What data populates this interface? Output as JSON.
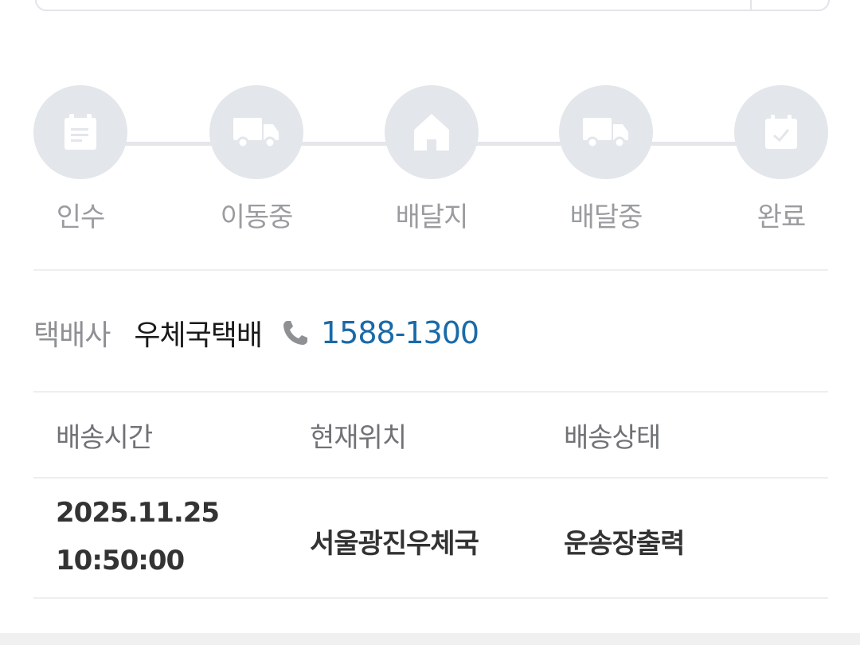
{
  "steps": [
    {
      "label": "인수",
      "icon": "document-icon"
    },
    {
      "label": "이동중",
      "icon": "truck-icon"
    },
    {
      "label": "배달지",
      "icon": "home-icon"
    },
    {
      "label": "배달중",
      "icon": "truck-icon"
    },
    {
      "label": "완료",
      "icon": "calendar-check-icon"
    }
  ],
  "carrier": {
    "key": "택배사",
    "name": "우체국택배",
    "phone": "1588-1300"
  },
  "table": {
    "headers": [
      "배송시간",
      "현재위치",
      "배송상태"
    ],
    "rows": [
      {
        "date": "2025.11.25",
        "time": "10:50:00",
        "location": "서울광진우체국",
        "status": "운송장출력"
      }
    ]
  },
  "colors": {
    "step_bg": "#e3e6ea",
    "step_icon": "#ffffff",
    "phone": "#1a6aa8"
  }
}
